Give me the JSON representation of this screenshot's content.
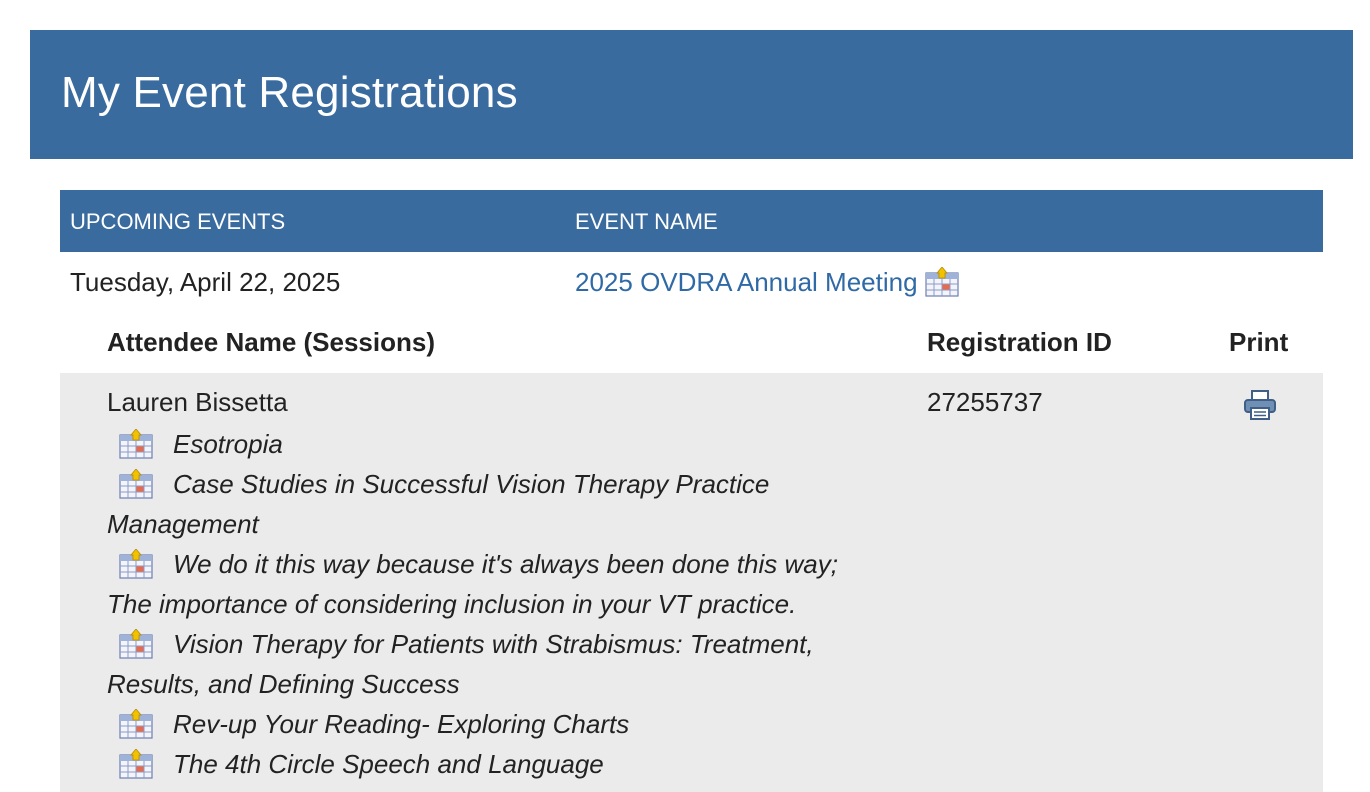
{
  "page": {
    "title": "My Event Registrations"
  },
  "table": {
    "headers": {
      "upcoming_events": "UPCOMING EVENTS",
      "event_name": "EVENT NAME"
    }
  },
  "event": {
    "date": "Tuesday, April 22, 2025",
    "name": "2025 OVDRA Annual Meeting",
    "calendar_icon": "add-to-calendar-icon"
  },
  "attendee_table": {
    "headers": {
      "name": "Attendee Name (Sessions)",
      "registration_id": "Registration ID",
      "print": "Print"
    },
    "attendee": {
      "name": "Lauren Bissetta",
      "registration_id": "27255737",
      "print_icon": "printer-icon",
      "sessions": [
        "Esotropia",
        "Case Studies in Successful Vision Therapy Practice Management",
        "We do it this way because it's always been done this way; The importance of considering inclusion in your VT practice.",
        "Vision Therapy for Patients with Strabismus: Treatment, Results, and Defining Success",
        "Rev-up Your Reading- Exploring Charts",
        "The 4th Circle Speech and Language"
      ]
    }
  },
  "colors": {
    "brand": "#3a6b9f",
    "link": "#2f6aa6",
    "row_bg": "#ebebeb"
  }
}
